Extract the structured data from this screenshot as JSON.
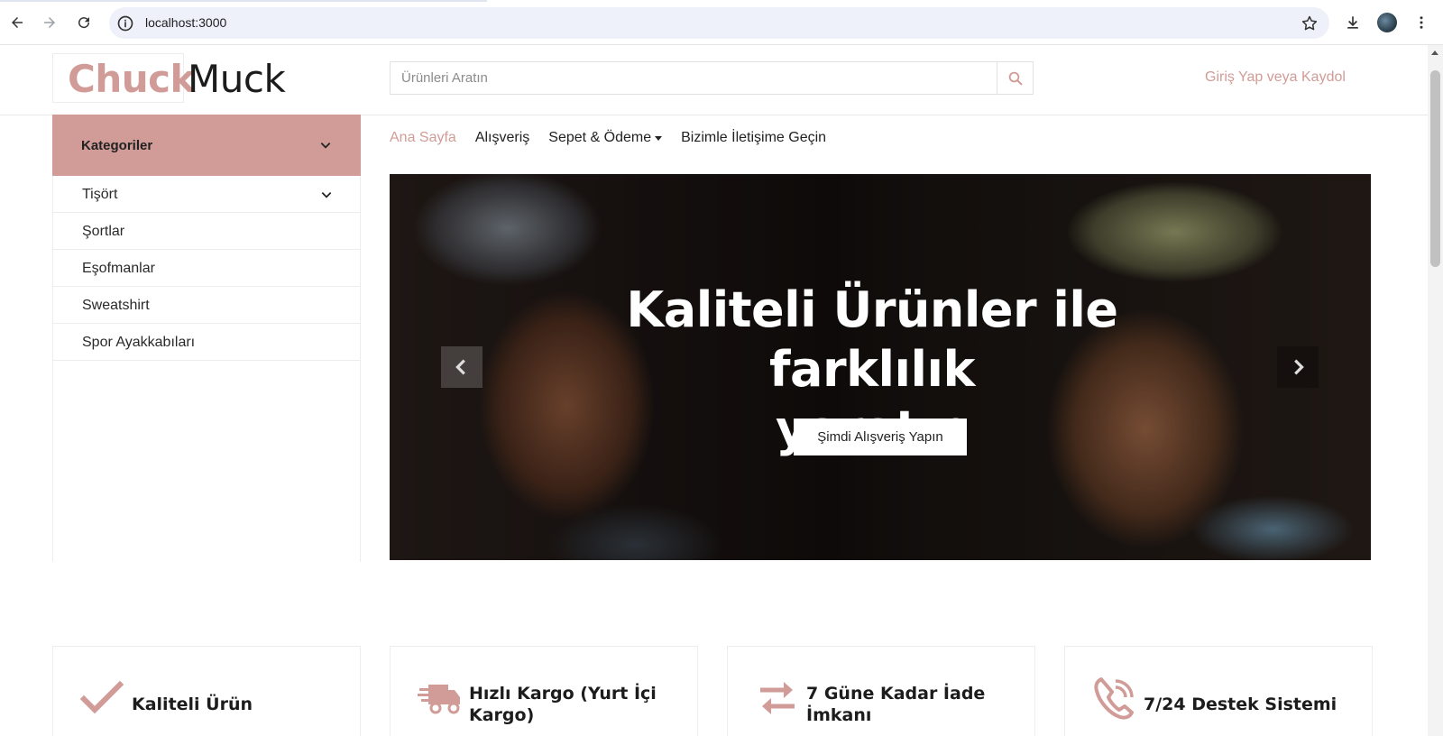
{
  "browser": {
    "url": "localhost:3000"
  },
  "header": {
    "logo_part1": "Chuck",
    "logo_part2": "Muck",
    "search_placeholder": "Ürünleri Aratın",
    "login_label": "Giriş Yap veya Kaydol"
  },
  "sidebar": {
    "title": "Kategoriler",
    "items": [
      {
        "label": "Tişört",
        "has_children": true
      },
      {
        "label": "Şortlar"
      },
      {
        "label": "Eşofmanlar"
      },
      {
        "label": "Sweatshirt"
      },
      {
        "label": "Spor Ayakkabıları"
      }
    ]
  },
  "nav": {
    "items": [
      {
        "label": "Ana Sayfa",
        "active": true
      },
      {
        "label": "Alışveriş"
      },
      {
        "label": "Sepet & Ödeme",
        "dropdown": true
      },
      {
        "label": "Bizimle İletişime Geçin"
      }
    ]
  },
  "hero": {
    "title_line1": "Kaliteli Ürünler ile farklılık",
    "title_line2": "yaratın",
    "button_label": "Şimdi Alışveriş Yapın"
  },
  "features": [
    {
      "label": "Kaliteli Ürün",
      "icon": "check-icon"
    },
    {
      "label": "Hızlı Kargo (Yurt İçi Kargo)",
      "line1": "Hızlı Kargo (Yurt İçi",
      "line2": "Kargo)",
      "icon": "shipping-fast-icon"
    },
    {
      "label": "7 Güne Kadar İade İmkanı",
      "line1": "7 Güne Kadar İade",
      "line2": "İmkanı",
      "icon": "exchange-icon"
    },
    {
      "label": "7/24 Destek Sistemi",
      "icon": "phone-volume-icon"
    }
  ],
  "colors": {
    "brand": "#d19c97",
    "text": "#222222"
  }
}
